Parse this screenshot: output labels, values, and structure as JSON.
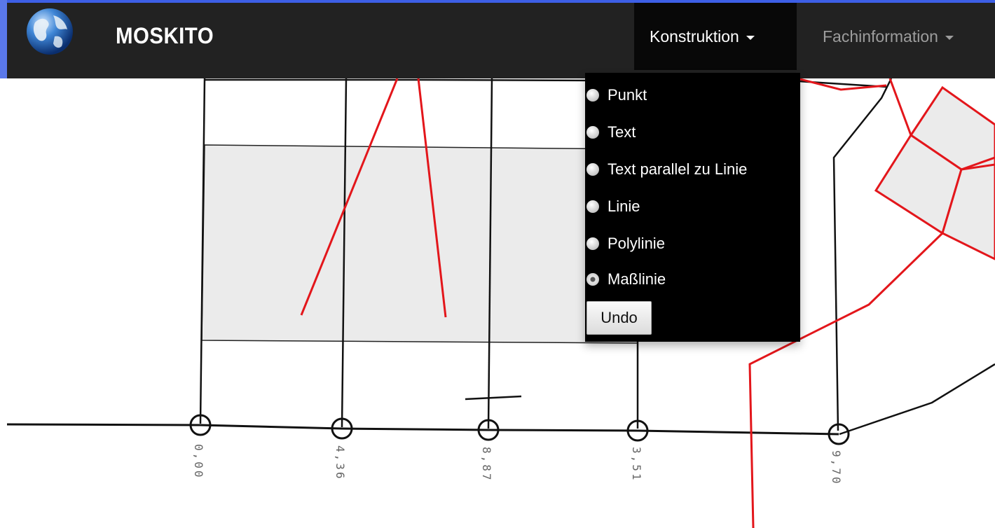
{
  "app": {
    "brand": "MOSKITO"
  },
  "nav": {
    "konstruktion": "Konstruktion",
    "fachinformation": "Fachinformation"
  },
  "dropdown": {
    "items": [
      {
        "label": "Punkt",
        "checked": false
      },
      {
        "label": "Text",
        "checked": false
      },
      {
        "label": "Text parallel zu Linie",
        "checked": false
      },
      {
        "label": "Linie",
        "checked": false
      },
      {
        "label": "Polylinie",
        "checked": false
      },
      {
        "label": "Maßlinie",
        "checked": true
      }
    ],
    "undo": "Undo"
  },
  "map": {
    "station_labels": [
      "0,00",
      "4,36",
      "8,87",
      "3,51",
      "9,70"
    ]
  },
  "colors": {
    "navbar": "#222222",
    "active_nav": "#080808",
    "red_lines": "#e3161b",
    "polygon_fill": "#ebebeb"
  }
}
